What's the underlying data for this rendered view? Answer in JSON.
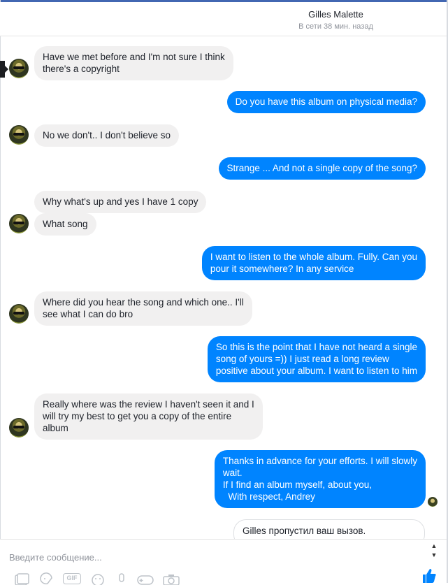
{
  "header": {
    "name": "Gilles Malette",
    "status": "В сети 38 мин. назад"
  },
  "messages": [
    {
      "dir": "in",
      "lines": [
        "Have we met before and I'm not sure I think",
        "there's a copyright"
      ]
    },
    {
      "dir": "out",
      "lines": [
        "Do you have this album on physical media?"
      ]
    },
    {
      "dir": "in",
      "lines": [
        "No we don't.. I don't believe so"
      ]
    },
    {
      "dir": "out",
      "lines": [
        "Strange ... And not a single copy of the song?"
      ]
    },
    {
      "dir": "in",
      "lines": [
        "Why what's up and yes I have 1 copy"
      ]
    },
    {
      "dir": "in",
      "lines": [
        "What song"
      ]
    },
    {
      "dir": "out",
      "lines": [
        "I want to listen to the whole album. Fully. Can you",
        "pour it somewhere? In any service"
      ]
    },
    {
      "dir": "in",
      "lines": [
        "Where did you hear the song and which one.. I'll",
        "see what I can do bro"
      ]
    },
    {
      "dir": "out",
      "lines": [
        "So this is the point that I have not heard a single",
        "song of yours =)) I just read a long review",
        "positive about your album. I want to listen to him"
      ]
    },
    {
      "dir": "in",
      "lines": [
        "Really where was the review I haven't seen it and I",
        "will try my best to get you a copy of the entire",
        "album"
      ]
    },
    {
      "dir": "out",
      "lines": [
        "Thanks in advance for your efforts. I will slowly",
        "wait.",
        "If I find an album myself, about you,",
        "  With respect, Andrey"
      ]
    }
  ],
  "call_notice": "Gilles пропустил ваш вызов.",
  "composer": {
    "placeholder": "Введите сообщение...",
    "gif_label": "GIF"
  },
  "icons": [
    "photo-icon",
    "sticker-icon",
    "gif-icon",
    "emoji-icon",
    "microphone-icon",
    "game-icon",
    "camera-icon",
    "like-icon"
  ],
  "colors": {
    "outgoing_bubble": "#0084ff",
    "incoming_bubble": "#f1f0f0",
    "like_icon": "#0084ff"
  }
}
